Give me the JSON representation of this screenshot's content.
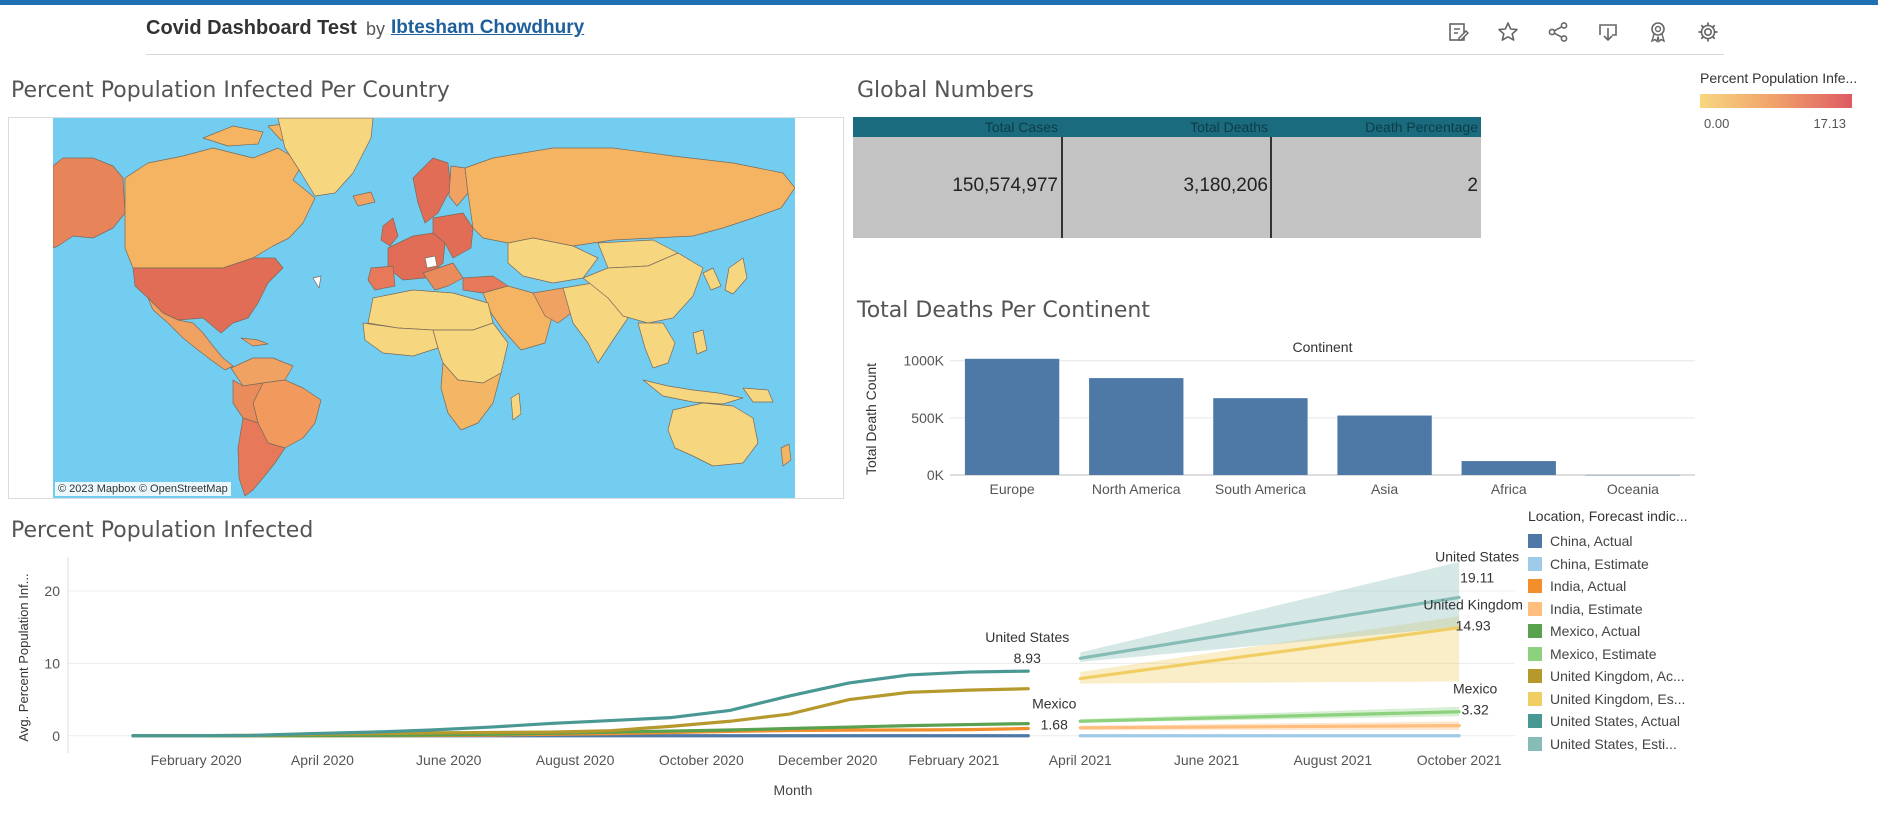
{
  "header": {
    "title": "Covid Dashboard Test",
    "by": "by",
    "author": "Ibtesham Chowdhury",
    "toolbar_icons": [
      "edit-icon",
      "star-icon",
      "share-icon",
      "download-icon",
      "badge-icon",
      "gear-icon"
    ]
  },
  "map": {
    "title": "Percent Population Infected Per Country",
    "attribution": "© 2023 Mapbox  © OpenStreetMap"
  },
  "color_legend": {
    "title": "Percent Population Infe...",
    "min": "0.00",
    "max": "17.13",
    "colors": [
      "#f8d780",
      "#f0a06a",
      "#dd5a63"
    ]
  },
  "global": {
    "title": "Global Numbers",
    "columns": [
      "Total Cases",
      "Total Deaths",
      "Death Percentage"
    ],
    "values": [
      "150,574,977",
      "3,180,206",
      "2"
    ]
  },
  "deaths_title": "Total Deaths Per Continent",
  "infected_title": "Percent Population Infected",
  "line_legend": {
    "title": "Location, Forecast indic...",
    "items": [
      {
        "label": "China, Actual",
        "color": "#4e79a7"
      },
      {
        "label": "China, Estimate",
        "color": "#a0cbe8"
      },
      {
        "label": "India, Actual",
        "color": "#f28e2b"
      },
      {
        "label": "India, Estimate",
        "color": "#ffbe7d"
      },
      {
        "label": "Mexico, Actual",
        "color": "#59a14f"
      },
      {
        "label": "Mexico, Estimate",
        "color": "#8cd17d"
      },
      {
        "label": "United Kingdom, Ac...",
        "color": "#b6992d"
      },
      {
        "label": "United Kingdom, Es...",
        "color": "#f1ce63"
      },
      {
        "label": "United States, Actual",
        "color": "#499894"
      },
      {
        "label": "United States, Esti...",
        "color": "#86bcb6"
      }
    ]
  },
  "chart_data": [
    {
      "type": "bar",
      "title": "Total Deaths Per Continent",
      "header_label": "Continent",
      "ylabel": "Total Death Count",
      "categories": [
        "Europe",
        "North America",
        "South America",
        "Asia",
        "Africa",
        "Oceania"
      ],
      "values": [
        1016750,
        847942,
        672415,
        520269,
        121784,
        1046
      ],
      "ylim": [
        0,
        1050000
      ],
      "yticks": [
        0,
        500000,
        1000000
      ],
      "ytick_labels": [
        "0K",
        "500K",
        "1000K"
      ],
      "color": "#4e79a7",
      "grid": true
    },
    {
      "type": "line",
      "title": "Percent Population Infected",
      "xlabel": "Month",
      "ylabel": "Avg. Percent Population Inf...",
      "ylim": [
        -1,
        24
      ],
      "yticks": [
        0,
        10,
        20
      ],
      "xtick_labels": [
        "February 2020",
        "April 2020",
        "June 2020",
        "August 2020",
        "October 2020",
        "December 2020",
        "February 2021",
        "April 2021",
        "June 2021",
        "August 2021",
        "October 2021"
      ],
      "actual_months": [
        "Jan 2020",
        "Feb 2020",
        "Mar 2020",
        "Apr 2020",
        "May 2020",
        "Jun 2020",
        "Jul 2020",
        "Aug 2020",
        "Sep 2020",
        "Oct 2020",
        "Nov 2020",
        "Dec 2020",
        "Jan 2021",
        "Feb 2021",
        "Mar 2021",
        "Apr 2021"
      ],
      "forecast_months": [
        "May 2021",
        "Oct 2021"
      ],
      "series": [
        {
          "name": "China, Actual",
          "color": "#4e79a7",
          "values": [
            0,
            0,
            0,
            0,
            0,
            0,
            0,
            0,
            0,
            0,
            0,
            0,
            0,
            0,
            0,
            0
          ]
        },
        {
          "name": "China, Estimate",
          "color": "#a0cbe8",
          "values": [
            0,
            0
          ],
          "band": [
            [
              0,
              0
            ],
            [
              0,
              0
            ]
          ]
        },
        {
          "name": "India, Actual",
          "color": "#f28e2b",
          "values": [
            0,
            0,
            0,
            0,
            0.01,
            0.03,
            0.1,
            0.2,
            0.3,
            0.45,
            0.6,
            0.72,
            0.78,
            0.8,
            0.85,
            1.0
          ]
        },
        {
          "name": "India, Estimate",
          "color": "#ffbe7d",
          "values": [
            1.1,
            1.4
          ],
          "band": [
            [
              0.8,
              1.4
            ],
            [
              0.8,
              2.0
            ]
          ]
        },
        {
          "name": "Mexico, Actual",
          "color": "#59a14f",
          "values": [
            0,
            0,
            0.01,
            0.02,
            0.05,
            0.1,
            0.2,
            0.35,
            0.5,
            0.65,
            0.8,
            1.0,
            1.2,
            1.4,
            1.55,
            1.68
          ]
        },
        {
          "name": "Mexico, Estimate",
          "color": "#8cd17d",
          "values": [
            2.0,
            3.32
          ],
          "band": [
            [
              1.8,
              2.3
            ],
            [
              2.7,
              4.0
            ]
          ]
        },
        {
          "name": "United Kingdom, Actual",
          "color": "#b6992d",
          "values": [
            0,
            0,
            0.05,
            0.2,
            0.3,
            0.4,
            0.45,
            0.5,
            0.7,
            1.3,
            2.0,
            3.0,
            5.0,
            6.0,
            6.3,
            6.5
          ]
        },
        {
          "name": "United Kingdom, Estimate",
          "color": "#f1ce63",
          "values": [
            7.9,
            14.93
          ],
          "band": [
            [
              7.2,
              8.8
            ],
            [
              7.5,
              16.5
            ]
          ]
        },
        {
          "name": "United States, Actual",
          "color": "#499894",
          "values": [
            0,
            0,
            0.05,
            0.3,
            0.5,
            0.8,
            1.2,
            1.7,
            2.1,
            2.5,
            3.5,
            5.5,
            7.3,
            8.4,
            8.8,
            8.93
          ]
        },
        {
          "name": "United States, Estimate",
          "color": "#86bcb6",
          "values": [
            10.7,
            19.11
          ],
          "band": [
            [
              10.2,
              11.5
            ],
            [
              15.0,
              24.0
            ]
          ]
        }
      ],
      "annotations": [
        {
          "series": "United States, Actual",
          "name": "United States",
          "value": "8.93"
        },
        {
          "series": "Mexico, Actual",
          "name": "Mexico",
          "value": "1.68"
        },
        {
          "series": "United States, Estimate",
          "name": "United States",
          "value": "19.11"
        },
        {
          "series": "United Kingdom, Estimate",
          "name": "United Kingdom",
          "value": "14.93"
        },
        {
          "series": "Mexico, Estimate",
          "name": "Mexico",
          "value": "3.32"
        }
      ]
    }
  ]
}
